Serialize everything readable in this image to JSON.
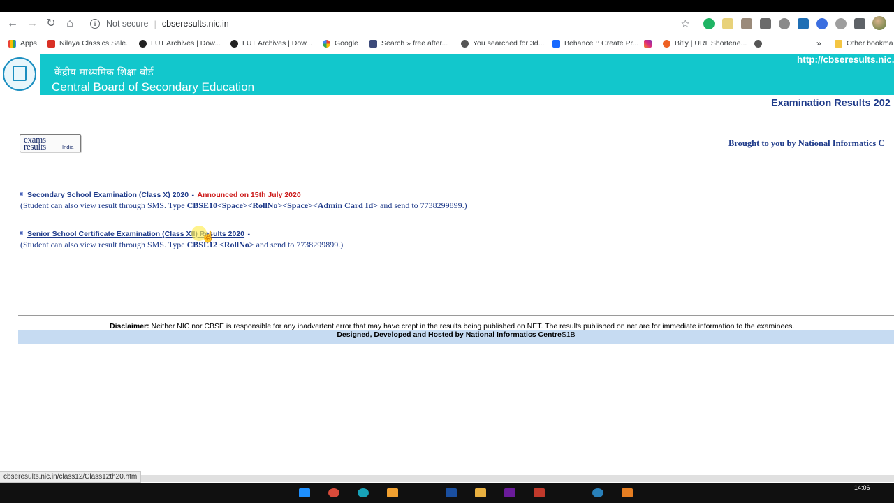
{
  "browser": {
    "security_label": "Not secure",
    "url": "cbseresults.nic.in",
    "bookmarks": [
      "Apps",
      "Nilaya Classics Sale...",
      "LUT Archives | Dow...",
      "LUT Archives | Dow...",
      "Google",
      "Search » free after...",
      "You searched for 3d...",
      "Behance :: Create Pr...",
      "Bitly | URL Shortene...",
      "»",
      "Other bookma"
    ],
    "status_url": "cbseresults.nic.in/class12/Class12th20.htm",
    "clock": "14:06"
  },
  "header": {
    "hindi_title": "केंद्रीय माध्यमिक शिक्षा बोर्ड",
    "english_title": "Central Board of Secondary Education",
    "site_url": "http://cbseresults.nic."
  },
  "page": {
    "exam_results_heading": "Examination Results 202",
    "logo_text": {
      "line1": "exams",
      "line2": "results",
      "line3": "India"
    },
    "brought_by": "Brought to you by National Informatics C",
    "entries": [
      {
        "link": "Secondary School Examination (Class X) 2020",
        "dash": "-",
        "announced": "Announced on 15th July 2020",
        "sms_prefix": "(Student can also view result through SMS. Type ",
        "sms_code": "CBSE10<Space><RollNo><Space><Admin Card Id>",
        "sms_suffix": " and send to 7738299899.)"
      },
      {
        "link": "Senior School Certificate Examination (Class XII) Results 2020",
        "dash": "-",
        "sms_prefix": "(Student can also view result through SMS. Type ",
        "sms_code": "CBSE12 <RollNo>",
        "sms_suffix": " and send to 7738299899.)"
      }
    ]
  },
  "footer": {
    "disclaimer_label": "Disclaimer:",
    "disclaimer_text": " Neither NIC nor CBSE is responsible for any inadvertent error that may have crept in the results being published on NET. The results published on net are for immediate information to the examinees.",
    "designed_bold": "Designed, Developed and Hosted by National Informatics Centre",
    "designed_suffix": "S1B"
  }
}
